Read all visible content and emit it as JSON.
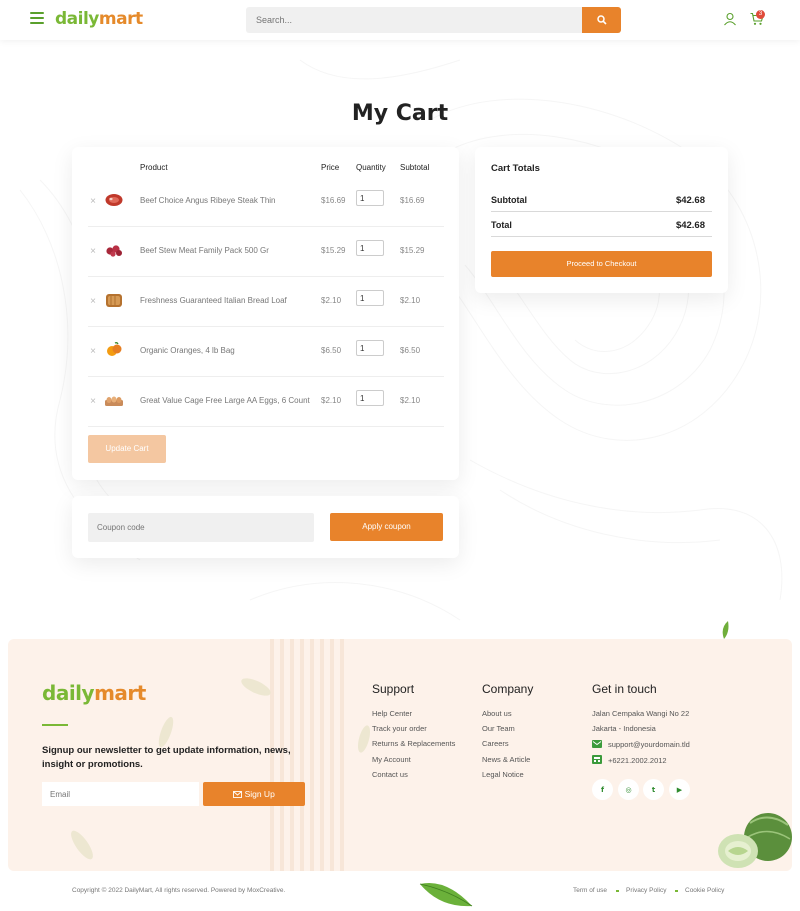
{
  "header": {
    "logo": {
      "part1": "daily",
      "part2": "mart"
    },
    "search_placeholder": "Search...",
    "cart_count": "3"
  },
  "page_title": "My Cart",
  "cart_table": {
    "headers": {
      "product": "Product",
      "price": "Price",
      "quantity": "Quantity",
      "subtotal": "Subtotal"
    },
    "rows": [
      {
        "name": "Beef Choice Angus Ribeye Steak Thin",
        "price": "$16.69",
        "qty": "1",
        "subtotal": "$16.69",
        "icon": "steak-icon"
      },
      {
        "name": "Beef Stew Meat Family Pack 500 Gr",
        "price": "$15.29",
        "qty": "1",
        "subtotal": "$15.29",
        "icon": "meat-icon"
      },
      {
        "name": "Freshness Guaranteed Italian Bread Loaf",
        "price": "$2.10",
        "qty": "1",
        "subtotal": "$2.10",
        "icon": "bread-icon"
      },
      {
        "name": "Organic Oranges, 4 lb Bag",
        "price": "$6.50",
        "qty": "1",
        "subtotal": "$6.50",
        "icon": "oranges-icon"
      },
      {
        "name": "Great Value Cage Free Large AA Eggs, 6 Count",
        "price": "$2.10",
        "qty": "1",
        "subtotal": "$2.10",
        "icon": "eggs-icon"
      }
    ],
    "remove_symbol": "×",
    "update_label": "Update Cart"
  },
  "coupon": {
    "placeholder": "Coupon code",
    "button_label": "Apply coupon"
  },
  "totals": {
    "title": "Cart Totals",
    "subtotal_label": "Subtotal",
    "subtotal_value": "$42.68",
    "total_label": "Total",
    "total_value": "$42.68",
    "checkout_label": "Proceed to Checkout"
  },
  "footer": {
    "logo": {
      "part1": "daily",
      "part2": "mart"
    },
    "newsletter_text": "Signup our newsletter to get update information, news, insight or promotions.",
    "email_placeholder": "Email",
    "signup_label": "Sign Up",
    "support": {
      "title": "Support",
      "links": [
        "Help Center",
        "Track your order",
        "Returns & Replacements",
        "My Account",
        "Contact us"
      ]
    },
    "company": {
      "title": "Company",
      "links": [
        "About us",
        "Our Team",
        "Careers",
        "News & Article",
        "Legal Notice"
      ]
    },
    "contact": {
      "title": "Get in touch",
      "address1": "Jalan Cempaka Wangi No 22",
      "address2": "Jakarta - Indonesia",
      "email": "support@yourdomain.tld",
      "phone": "+6221.2002.2012"
    },
    "social": [
      {
        "name": "facebook-icon",
        "glyph": "f"
      },
      {
        "name": "instagram-icon",
        "glyph": "◎"
      },
      {
        "name": "twitter-icon",
        "glyph": "t"
      },
      {
        "name": "youtube-icon",
        "glyph": "▶"
      }
    ]
  },
  "bottom_bar": {
    "copyright": "Copyright © 2022 DailyMart, All rights reserved. Powered by MoxCreative.",
    "links": [
      "Term of use",
      "Privacy Policy",
      "Cookie Policy"
    ]
  },
  "colors": {
    "accent": "#e8832b",
    "brand_green": "#7ab836",
    "footer_bg": "#fdf2ea"
  }
}
